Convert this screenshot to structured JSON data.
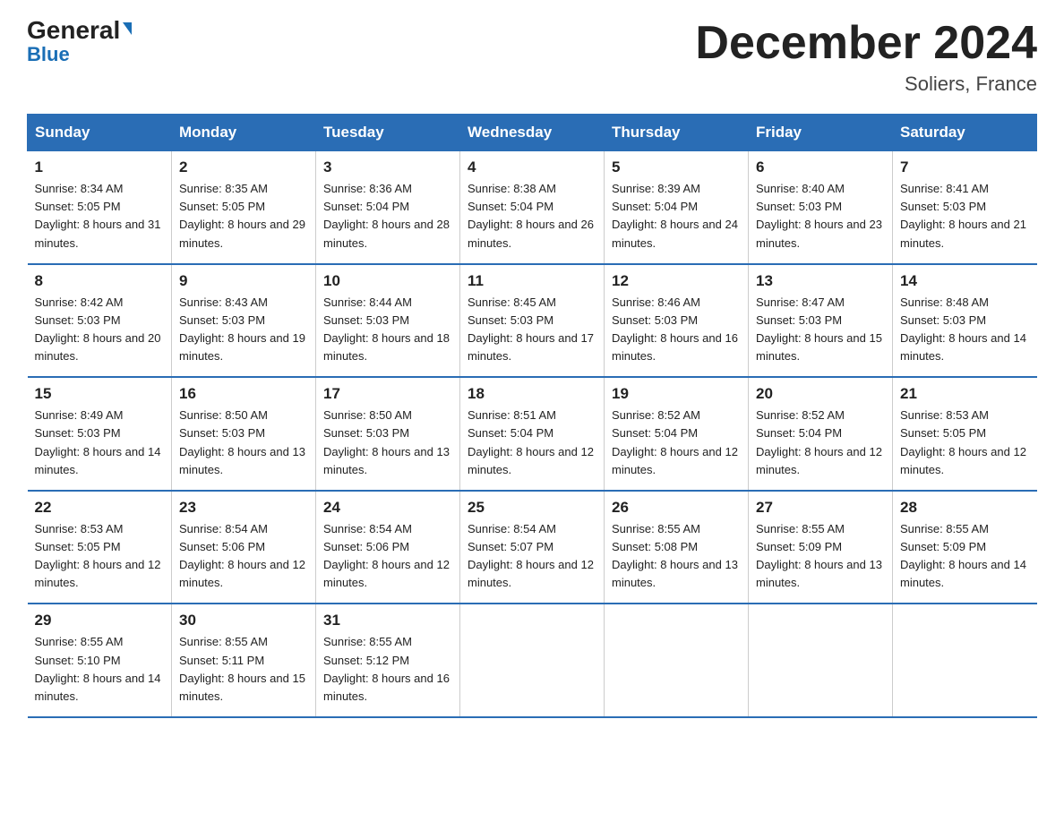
{
  "header": {
    "logo_general": "General",
    "logo_blue": "Blue",
    "month_title": "December 2024",
    "location": "Soliers, France"
  },
  "days_of_week": [
    "Sunday",
    "Monday",
    "Tuesday",
    "Wednesday",
    "Thursday",
    "Friday",
    "Saturday"
  ],
  "weeks": [
    [
      {
        "day": "1",
        "sunrise": "8:34 AM",
        "sunset": "5:05 PM",
        "daylight": "8 hours and 31 minutes."
      },
      {
        "day": "2",
        "sunrise": "8:35 AM",
        "sunset": "5:05 PM",
        "daylight": "8 hours and 29 minutes."
      },
      {
        "day": "3",
        "sunrise": "8:36 AM",
        "sunset": "5:04 PM",
        "daylight": "8 hours and 28 minutes."
      },
      {
        "day": "4",
        "sunrise": "8:38 AM",
        "sunset": "5:04 PM",
        "daylight": "8 hours and 26 minutes."
      },
      {
        "day": "5",
        "sunrise": "8:39 AM",
        "sunset": "5:04 PM",
        "daylight": "8 hours and 24 minutes."
      },
      {
        "day": "6",
        "sunrise": "8:40 AM",
        "sunset": "5:03 PM",
        "daylight": "8 hours and 23 minutes."
      },
      {
        "day": "7",
        "sunrise": "8:41 AM",
        "sunset": "5:03 PM",
        "daylight": "8 hours and 21 minutes."
      }
    ],
    [
      {
        "day": "8",
        "sunrise": "8:42 AM",
        "sunset": "5:03 PM",
        "daylight": "8 hours and 20 minutes."
      },
      {
        "day": "9",
        "sunrise": "8:43 AM",
        "sunset": "5:03 PM",
        "daylight": "8 hours and 19 minutes."
      },
      {
        "day": "10",
        "sunrise": "8:44 AM",
        "sunset": "5:03 PM",
        "daylight": "8 hours and 18 minutes."
      },
      {
        "day": "11",
        "sunrise": "8:45 AM",
        "sunset": "5:03 PM",
        "daylight": "8 hours and 17 minutes."
      },
      {
        "day": "12",
        "sunrise": "8:46 AM",
        "sunset": "5:03 PM",
        "daylight": "8 hours and 16 minutes."
      },
      {
        "day": "13",
        "sunrise": "8:47 AM",
        "sunset": "5:03 PM",
        "daylight": "8 hours and 15 minutes."
      },
      {
        "day": "14",
        "sunrise": "8:48 AM",
        "sunset": "5:03 PM",
        "daylight": "8 hours and 14 minutes."
      }
    ],
    [
      {
        "day": "15",
        "sunrise": "8:49 AM",
        "sunset": "5:03 PM",
        "daylight": "8 hours and 14 minutes."
      },
      {
        "day": "16",
        "sunrise": "8:50 AM",
        "sunset": "5:03 PM",
        "daylight": "8 hours and 13 minutes."
      },
      {
        "day": "17",
        "sunrise": "8:50 AM",
        "sunset": "5:03 PM",
        "daylight": "8 hours and 13 minutes."
      },
      {
        "day": "18",
        "sunrise": "8:51 AM",
        "sunset": "5:04 PM",
        "daylight": "8 hours and 12 minutes."
      },
      {
        "day": "19",
        "sunrise": "8:52 AM",
        "sunset": "5:04 PM",
        "daylight": "8 hours and 12 minutes."
      },
      {
        "day": "20",
        "sunrise": "8:52 AM",
        "sunset": "5:04 PM",
        "daylight": "8 hours and 12 minutes."
      },
      {
        "day": "21",
        "sunrise": "8:53 AM",
        "sunset": "5:05 PM",
        "daylight": "8 hours and 12 minutes."
      }
    ],
    [
      {
        "day": "22",
        "sunrise": "8:53 AM",
        "sunset": "5:05 PM",
        "daylight": "8 hours and 12 minutes."
      },
      {
        "day": "23",
        "sunrise": "8:54 AM",
        "sunset": "5:06 PM",
        "daylight": "8 hours and 12 minutes."
      },
      {
        "day": "24",
        "sunrise": "8:54 AM",
        "sunset": "5:06 PM",
        "daylight": "8 hours and 12 minutes."
      },
      {
        "day": "25",
        "sunrise": "8:54 AM",
        "sunset": "5:07 PM",
        "daylight": "8 hours and 12 minutes."
      },
      {
        "day": "26",
        "sunrise": "8:55 AM",
        "sunset": "5:08 PM",
        "daylight": "8 hours and 13 minutes."
      },
      {
        "day": "27",
        "sunrise": "8:55 AM",
        "sunset": "5:09 PM",
        "daylight": "8 hours and 13 minutes."
      },
      {
        "day": "28",
        "sunrise": "8:55 AM",
        "sunset": "5:09 PM",
        "daylight": "8 hours and 14 minutes."
      }
    ],
    [
      {
        "day": "29",
        "sunrise": "8:55 AM",
        "sunset": "5:10 PM",
        "daylight": "8 hours and 14 minutes."
      },
      {
        "day": "30",
        "sunrise": "8:55 AM",
        "sunset": "5:11 PM",
        "daylight": "8 hours and 15 minutes."
      },
      {
        "day": "31",
        "sunrise": "8:55 AM",
        "sunset": "5:12 PM",
        "daylight": "8 hours and 16 minutes."
      },
      null,
      null,
      null,
      null
    ]
  ]
}
